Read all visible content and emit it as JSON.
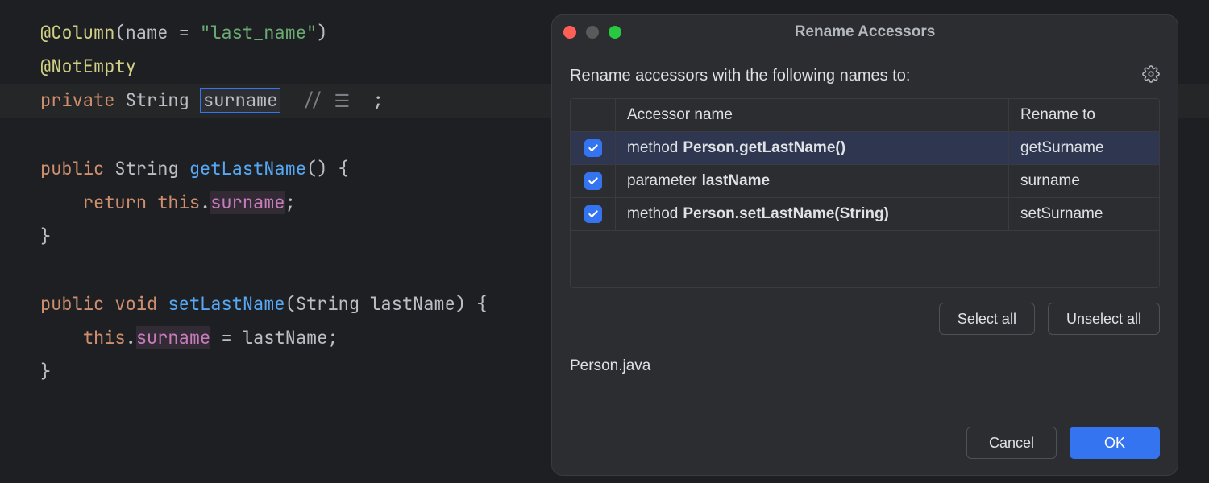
{
  "editor": {
    "ann_column": "@Column",
    "ann_column_attr": "name",
    "ann_column_value": "\"last_name\"",
    "ann_notempty": "@NotEmpty",
    "private_kw": "private",
    "string_type": "String",
    "field_name": "surname",
    "comment_slashes": "//",
    "semicolon": ";",
    "public_kw": "public",
    "void_kw": "void",
    "getter_name": "getLastName",
    "return_kw": "return",
    "this_kw": "this",
    "setter_name": "setLastName",
    "param_type": "String",
    "param_name": "lastName",
    "eq": "=",
    "open_brace": "{",
    "close_brace": "}"
  },
  "dialog": {
    "title": "Rename Accessors",
    "prompt": "Rename accessors with the following names to:",
    "columns": {
      "accessor": "Accessor name",
      "rename_to": "Rename to"
    },
    "rows": [
      {
        "checked": true,
        "kind": "method",
        "signature": "Person.getLastName()",
        "rename_to": "getSurname",
        "selected": true
      },
      {
        "checked": true,
        "kind": "parameter",
        "signature": "lastName",
        "rename_to": "surname",
        "selected": false
      },
      {
        "checked": true,
        "kind": "method",
        "signature": "Person.setLastName(String)",
        "rename_to": "setSurname",
        "selected": false
      }
    ],
    "select_all": "Select all",
    "unselect_all": "Unselect all",
    "usage_file": "Person.java",
    "cancel": "Cancel",
    "ok": "OK"
  }
}
